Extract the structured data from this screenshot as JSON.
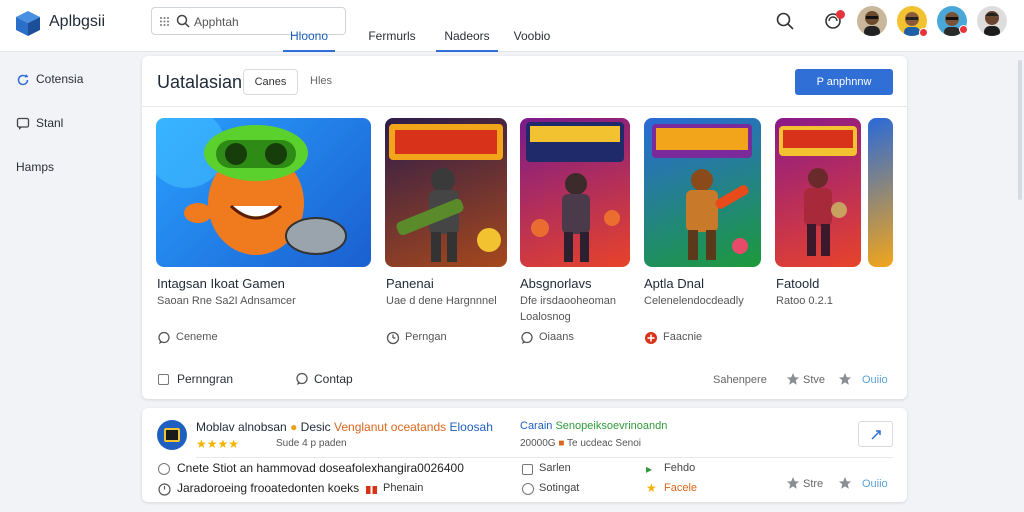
{
  "header": {
    "app_name": "Aplbgsii",
    "search": {
      "placeholder": "Apphtah",
      "value": ""
    },
    "tabs": [
      {
        "label": "Hloono",
        "active": true
      },
      {
        "label": "Fermurls",
        "active": false
      },
      {
        "label": "Nadeors",
        "active": false
      },
      {
        "label": "Voobio",
        "active": false
      }
    ]
  },
  "sidebar": {
    "items": [
      {
        "label": "Cotensia",
        "icon": "refresh-icon"
      },
      {
        "label": "Stanl",
        "icon": "chat-icon"
      },
      {
        "label": "Hamps",
        "icon": ""
      }
    ]
  },
  "main": {
    "title": "Uatalasian",
    "chip_label": "Canes",
    "chip2_label": "Hles",
    "primary_button": "P anphnnw",
    "games": [
      {
        "title": "Intagsan Ikoat Gamen",
        "subtitle": "Saoan Rne Sa2I Adnsamcer",
        "subtitle2": "",
        "meta": "Ceneme",
        "meta_icon": "comment-icon"
      },
      {
        "title": "Panenai",
        "subtitle": "Uae d dene Hargnnnel",
        "subtitle2": "",
        "meta": "Perngan",
        "meta_icon": "clock-icon"
      },
      {
        "title": "Absgnorlavs",
        "subtitle": "Dfe irsdaooheoman",
        "subtitle2": "Loalosnog",
        "meta": "Oiaans",
        "meta_icon": "comment-icon"
      },
      {
        "title": "Aptla Dnal",
        "subtitle": "Celenelendocdeadly",
        "subtitle2": "",
        "meta": "Faacnie",
        "meta_icon": "plus-badge-icon"
      },
      {
        "title": "Fatoold",
        "subtitle": "Ratoo 0.2.1",
        "subtitle2": "",
        "meta": "",
        "meta_icon": ""
      }
    ],
    "footer": {
      "checkbox_label": "Pernngran",
      "comment_label": "Contap",
      "small1": "Sahenpere",
      "small2": "Stve",
      "small3": "Ouiio"
    }
  },
  "second_card": {
    "title_part1": "Moblav alnobsan",
    "title_part2": "Desic",
    "title_part3": "Venglanut",
    "title_part4": "oceatands",
    "title_part5": "Eloosah",
    "stars": "★★★★",
    "rating_text": "Sude 4 p paden",
    "right_title_blue": "Carain",
    "right_title_green": "Senopeiksoevrinoandn",
    "right_sub_num": "20000G",
    "right_sub_text": "Te ucdeac",
    "right_sub_end": "Senoi",
    "row1_text": "Cnete Stiot an hammovad doseafolexhangira0026400",
    "row2_text": "Jaradoroeing frooatedonten koeks",
    "row2_end": "Phenain",
    "mid_row1": "Sarlen",
    "mid_row2": "Sotingat",
    "right_row1": "Fehdo",
    "right_row2": "Facele",
    "small1": "Stre",
    "small2": "Ouiio"
  },
  "colors": {
    "accent": "#2f6fd6",
    "notification": "#e5343a",
    "star": "#f2b400",
    "link_blue": "#1f5fbf",
    "green": "#2f9a3a",
    "orange": "#d9661c"
  }
}
